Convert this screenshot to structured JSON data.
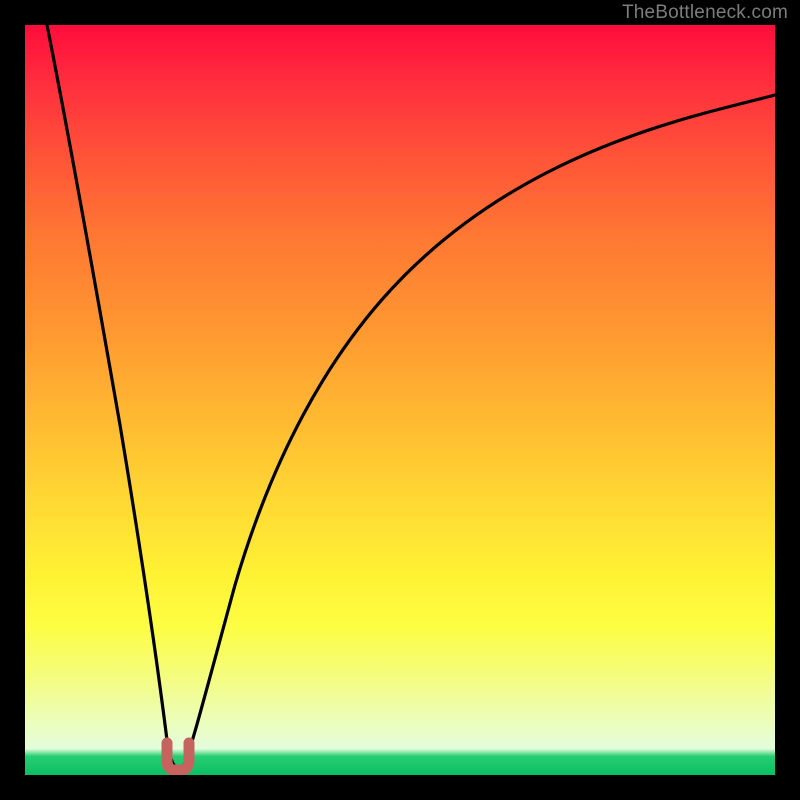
{
  "watermark": "TheBottleneck.com",
  "colors": {
    "frame": "#000000",
    "curve_stroke": "#000000",
    "marker_fill": "#c5645f",
    "watermark_text": "#7d7d7d"
  },
  "chart_data": {
    "type": "line",
    "title": "",
    "xlabel": "",
    "ylabel": "",
    "xlim": [
      0,
      100
    ],
    "ylim": [
      0,
      100
    ],
    "grid": false,
    "series": [
      {
        "name": "bottleneck-curve-left",
        "x": [
          3,
          5,
          8,
          11,
          14,
          17,
          18.5,
          19.3
        ],
        "y": [
          100,
          88,
          70,
          52,
          33,
          15,
          5,
          1
        ]
      },
      {
        "name": "bottleneck-curve-right",
        "x": [
          21.3,
          23,
          26,
          30,
          36,
          44,
          54,
          66,
          80,
          94,
          100
        ],
        "y": [
          1,
          6,
          18,
          32,
          47,
          59,
          69,
          77,
          83,
          87,
          89
        ]
      }
    ],
    "marker": {
      "name": "current-config",
      "shape": "u",
      "x_range": [
        19.3,
        21.3
      ],
      "y": 1
    },
    "background_gradient_stops": [
      {
        "pos": 0.0,
        "hex": "#ff0d3b"
      },
      {
        "pos": 0.18,
        "hex": "#ff5538"
      },
      {
        "pos": 0.4,
        "hex": "#ff9631"
      },
      {
        "pos": 0.63,
        "hex": "#ffd733"
      },
      {
        "pos": 0.8,
        "hex": "#fdfd41"
      },
      {
        "pos": 0.965,
        "hex": "#e4fddc"
      },
      {
        "pos": 0.975,
        "hex": "#27ce72"
      },
      {
        "pos": 1.0,
        "hex": "#0abf62"
      }
    ]
  }
}
